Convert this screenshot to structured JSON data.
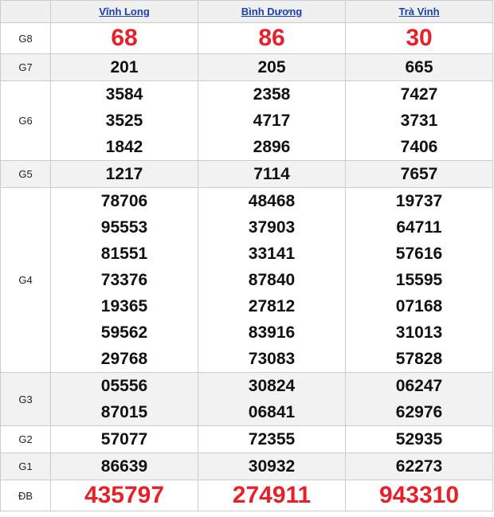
{
  "provinces": [
    {
      "name": "Vĩnh Long"
    },
    {
      "name": "Bình Dương"
    },
    {
      "name": "Trà Vinh"
    }
  ],
  "prizes": [
    {
      "label": "G8",
      "numbers": [
        [
          "68"
        ],
        [
          "86"
        ],
        [
          "30"
        ]
      ]
    },
    {
      "label": "G7",
      "numbers": [
        [
          "201"
        ],
        [
          "205"
        ],
        [
          "665"
        ]
      ]
    },
    {
      "label": "G6",
      "numbers": [
        [
          "3584",
          "3525",
          "1842"
        ],
        [
          "2358",
          "4717",
          "2896"
        ],
        [
          "7427",
          "3731",
          "7406"
        ]
      ]
    },
    {
      "label": "G5",
      "numbers": [
        [
          "1217"
        ],
        [
          "7114"
        ],
        [
          "7657"
        ]
      ]
    },
    {
      "label": "G4",
      "numbers": [
        [
          "78706",
          "95553",
          "81551",
          "73376",
          "19365",
          "59562",
          "29768"
        ],
        [
          "48468",
          "37903",
          "33141",
          "87840",
          "27812",
          "83916",
          "73083"
        ],
        [
          "19737",
          "64711",
          "57616",
          "15595",
          "07168",
          "31013",
          "57828"
        ]
      ]
    },
    {
      "label": "G3",
      "numbers": [
        [
          "05556",
          "87015"
        ],
        [
          "30824",
          "06841"
        ],
        [
          "06247",
          "62976"
        ]
      ]
    },
    {
      "label": "G2",
      "numbers": [
        [
          "57077"
        ],
        [
          "72355"
        ],
        [
          "52935"
        ]
      ]
    },
    {
      "label": "G1",
      "numbers": [
        [
          "86639"
        ],
        [
          "30932"
        ],
        [
          "62273"
        ]
      ]
    },
    {
      "label": "ĐB",
      "numbers": [
        [
          "435797"
        ],
        [
          "274911"
        ],
        [
          "943310"
        ]
      ]
    }
  ],
  "colors": {
    "highlight": "#e8202a",
    "link": "#1a3fb0",
    "alt_row": "#f2f2f2",
    "border": "#cccccc"
  }
}
